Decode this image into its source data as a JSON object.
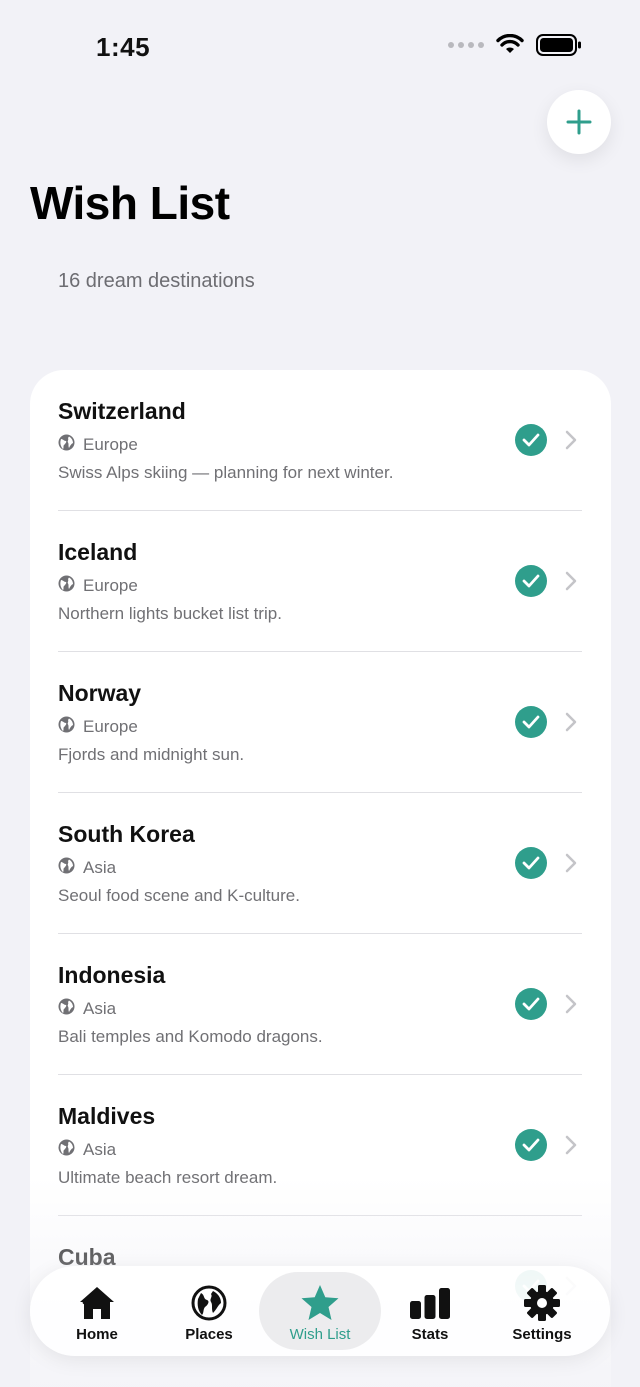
{
  "status_bar": {
    "time": "1:45"
  },
  "header": {
    "title": "Wish List",
    "subtitle": "16 dream destinations",
    "add_icon": "plus-icon"
  },
  "colors": {
    "accent": "#2f9e8c",
    "background": "#f2f2f7",
    "card": "#ffffff",
    "secondary_text": "#707074"
  },
  "destinations": [
    {
      "name": "Switzerland",
      "region": "Europe",
      "note": "Swiss Alps skiing — planning for next winter.",
      "checked": true,
      "region_icon": "globe-europe-icon"
    },
    {
      "name": "Iceland",
      "region": "Europe",
      "note": "Northern lights bucket list trip.",
      "checked": true,
      "region_icon": "globe-europe-icon"
    },
    {
      "name": "Norway",
      "region": "Europe",
      "note": "Fjords and midnight sun.",
      "checked": true,
      "region_icon": "globe-europe-icon"
    },
    {
      "name": "South Korea",
      "region": "Asia",
      "note": "Seoul food scene and K-culture.",
      "checked": true,
      "region_icon": "globe-asia-icon"
    },
    {
      "name": "Indonesia",
      "region": "Asia",
      "note": "Bali temples and Komodo dragons.",
      "checked": true,
      "region_icon": "globe-asia-icon"
    },
    {
      "name": "Maldives",
      "region": "Asia",
      "note": "Ultimate beach resort dream.",
      "checked": true,
      "region_icon": "globe-asia-icon"
    },
    {
      "name": "Cuba",
      "region": "",
      "note": "",
      "checked": true,
      "region_icon": "globe-americas-icon"
    }
  ],
  "tab_bar": {
    "tabs": [
      {
        "label": "Home",
        "icon": "house-icon",
        "active": false
      },
      {
        "label": "Places",
        "icon": "globe-icon",
        "active": false
      },
      {
        "label": "Wish List",
        "icon": "star-icon",
        "active": true
      },
      {
        "label": "Stats",
        "icon": "bar-chart-icon",
        "active": false
      },
      {
        "label": "Settings",
        "icon": "gear-icon",
        "active": false
      }
    ]
  }
}
